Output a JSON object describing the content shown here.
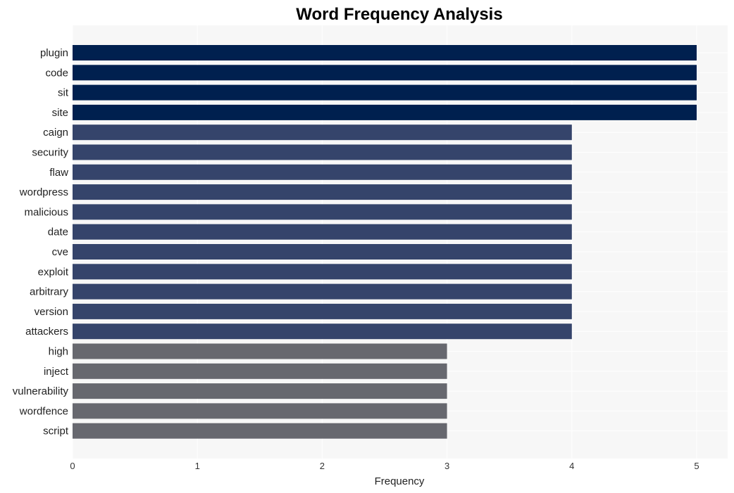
{
  "chart_data": {
    "type": "bar",
    "orientation": "horizontal",
    "title": "Word Frequency Analysis",
    "xlabel": "Frequency",
    "ylabel": "",
    "xlim": [
      0,
      5.25
    ],
    "xticks": [
      0,
      1,
      2,
      3,
      4,
      5
    ],
    "grid": true,
    "categories": [
      "plugin",
      "code",
      "sit",
      "site",
      "caign",
      "security",
      "flaw",
      "wordpress",
      "malicious",
      "date",
      "cve",
      "exploit",
      "arbitrary",
      "version",
      "attackers",
      "high",
      "inject",
      "vulnerability",
      "wordfence",
      "script"
    ],
    "values": [
      5,
      5,
      5,
      5,
      4,
      4,
      4,
      4,
      4,
      4,
      4,
      4,
      4,
      4,
      4,
      3,
      3,
      3,
      3,
      3
    ],
    "colors_by_value": {
      "5": "#00204f",
      "4": "#35446b",
      "3": "#67686f"
    },
    "background": "#f7f7f7",
    "gridline_color": "#ffffff"
  }
}
